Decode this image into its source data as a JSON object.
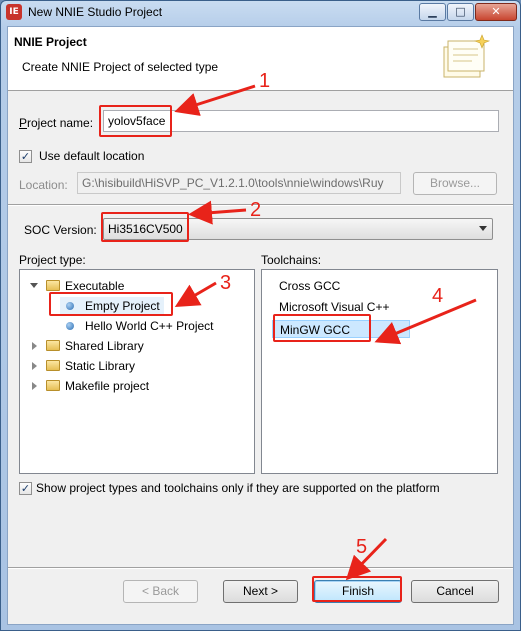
{
  "window": {
    "title": "New NNIE Studio Project",
    "app_icon_text": "IE"
  },
  "banner": {
    "title": "NNIE Project",
    "description": "Create NNIE Project of selected type"
  },
  "project_name": {
    "label": "Project name:",
    "value": "yolov5face"
  },
  "default_location": {
    "label": "Use default location",
    "checked": true
  },
  "location": {
    "label": "Location:",
    "value": "G:\\hisibuild\\HiSVP_PC_V1.2.1.0\\tools\\nnie\\windows\\Ruy",
    "browse_label": "Browse..."
  },
  "soc": {
    "label": "SOC Version:",
    "value": "Hi3516CV500"
  },
  "project_type": {
    "label": "Project type:",
    "items": [
      {
        "label": "Executable",
        "kind": "folder",
        "expanded": true
      },
      {
        "label": "Empty Project",
        "kind": "leaf",
        "selected": true
      },
      {
        "label": "Hello World C++ Project",
        "kind": "leaf"
      },
      {
        "label": "Shared Library",
        "kind": "folder"
      },
      {
        "label": "Static Library",
        "kind": "folder"
      },
      {
        "label": "Makefile project",
        "kind": "folder"
      }
    ]
  },
  "toolchains": {
    "label": "Toolchains:",
    "items": [
      {
        "label": "Cross GCC"
      },
      {
        "label": "Microsoft Visual C++"
      },
      {
        "label": "MinGW GCC",
        "selected": true
      }
    ]
  },
  "filter_checkbox": {
    "label": "Show project types and toolchains only if they are supported on the platform",
    "checked": true
  },
  "buttons": {
    "back": "< Back",
    "next": "Next >",
    "finish": "Finish",
    "cancel": "Cancel"
  },
  "annotations": [
    "1",
    "2",
    "3",
    "4",
    "5"
  ],
  "colors": {
    "annotation": "#e8231a",
    "title_bar": "#b5cde9",
    "dialog_bg": "#f0f0f0"
  }
}
